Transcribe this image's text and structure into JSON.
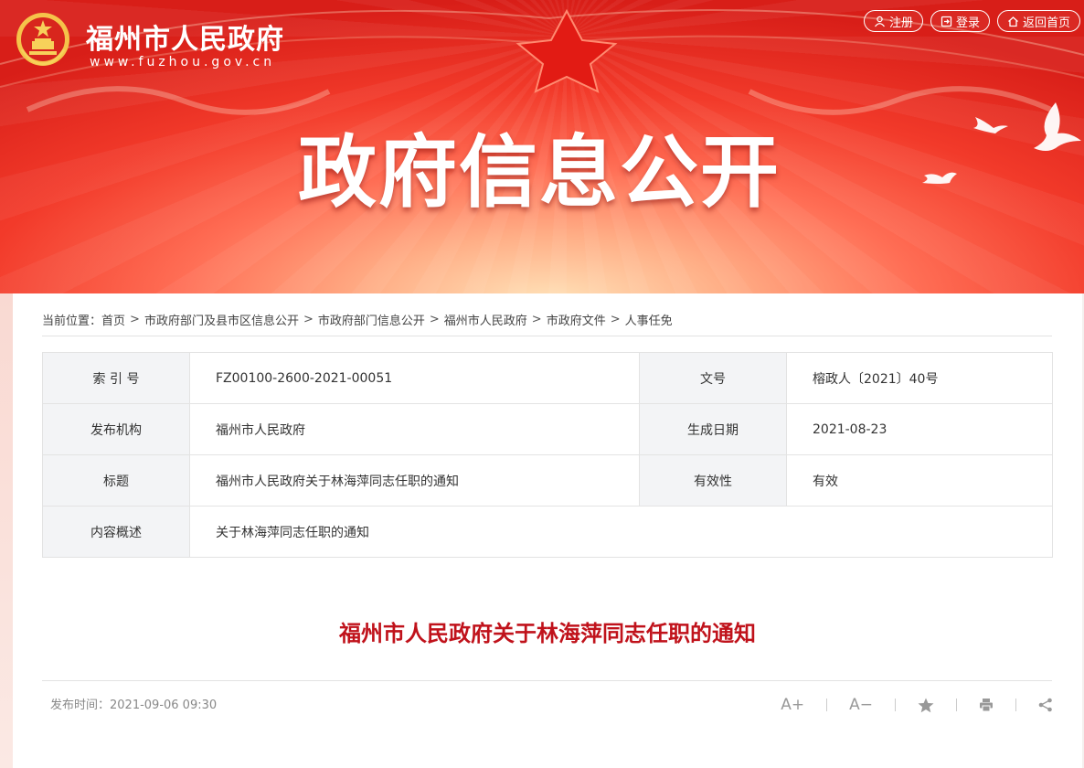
{
  "header": {
    "site_title": "福州市人民政府",
    "site_url": "www.fuzhou.gov.cn",
    "links": [
      {
        "label": "注册",
        "icon": "user-icon"
      },
      {
        "label": "登录",
        "icon": "login-icon"
      },
      {
        "label": "返回首页",
        "icon": "home-icon"
      }
    ],
    "banner_heading": "政府信息公开"
  },
  "breadcrumb": {
    "label": "当前位置：",
    "items": [
      "首页",
      "市政府部门及县市区信息公开",
      "市政府部门信息公开",
      "福州市人民政府",
      "市政府文件",
      "人事任免"
    ],
    "separator": ">"
  },
  "info_table": {
    "index_label": "索 引 号",
    "index_value": "FZ00100-2600-2021-00051",
    "doc_no_label": "文号",
    "doc_no_value": "榕政人〔2021〕40号",
    "issuer_label": "发布机构",
    "issuer_value": "福州市人民政府",
    "date_label": "生成日期",
    "date_value": "2021-08-23",
    "title_label": "标题",
    "title_value": "福州市人民政府关于林海萍同志任职的通知",
    "validity_label": "有效性",
    "validity_value": "有效",
    "summary_label": "内容概述",
    "summary_value": "关于林海萍同志任职的通知"
  },
  "article": {
    "title": "福州市人民政府关于林海萍同志任职的通知",
    "publish_time": "发布时间：2021-09-06 09:30"
  },
  "tools": {
    "font_up": "A+",
    "font_down": "A−",
    "icons": [
      "font-increase-icon",
      "font-decrease-icon",
      "star-icon",
      "print-icon",
      "share-icon"
    ]
  },
  "colors": {
    "banner_red": "#e8281e",
    "title_red": "#c0121b",
    "key_cell_bg": "#f3f4f6"
  }
}
